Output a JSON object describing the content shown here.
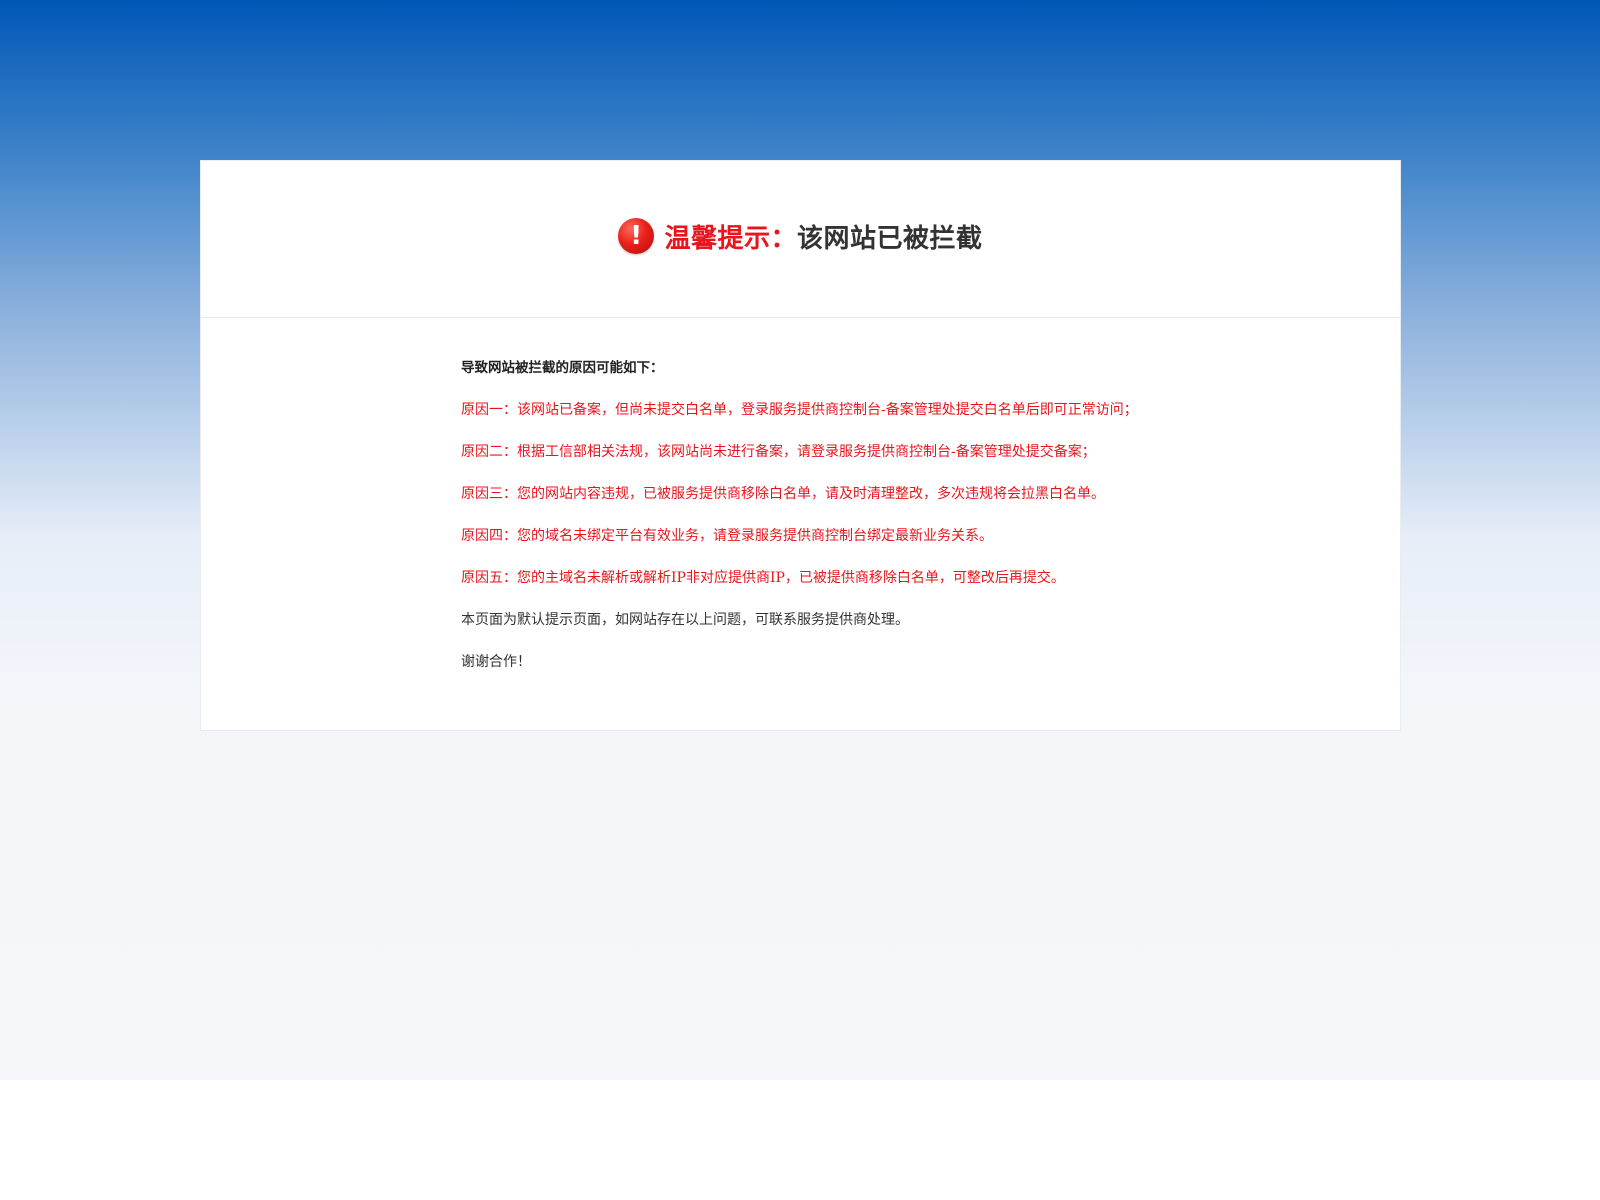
{
  "header": {
    "icon": "exclamation-circle-icon",
    "title_prefix": "温馨提示：",
    "title_main": "该网站已被拦截",
    "colors": {
      "accent": "#e8161c",
      "text": "#333333",
      "background_top": "#0157b6"
    }
  },
  "content": {
    "intro": "导致网站被拦截的原因可能如下：",
    "reasons": [
      "原因一：该网站已备案，但尚未提交白名单，登录服务提供商控制台-备案管理处提交白名单后即可正常访问；",
      "原因二：根据工信部相关法规，该网站尚未进行备案，请登录服务提供商控制台-备案管理处提交备案；",
      "原因三：您的网站内容违规，已被服务提供商移除白名单，请及时清理整改，多次违规将会拉黑白名单。",
      "原因四：您的域名未绑定平台有效业务，请登录服务提供商控制台绑定最新业务关系。",
      "原因五：您的主域名未解析或解析IP非对应提供商IP，已被提供商移除白名单，可整改后再提交。"
    ],
    "note": "本页面为默认提示页面，如网站存在以上问题，可联系服务提供商处理。",
    "thanks": "谢谢合作！"
  }
}
